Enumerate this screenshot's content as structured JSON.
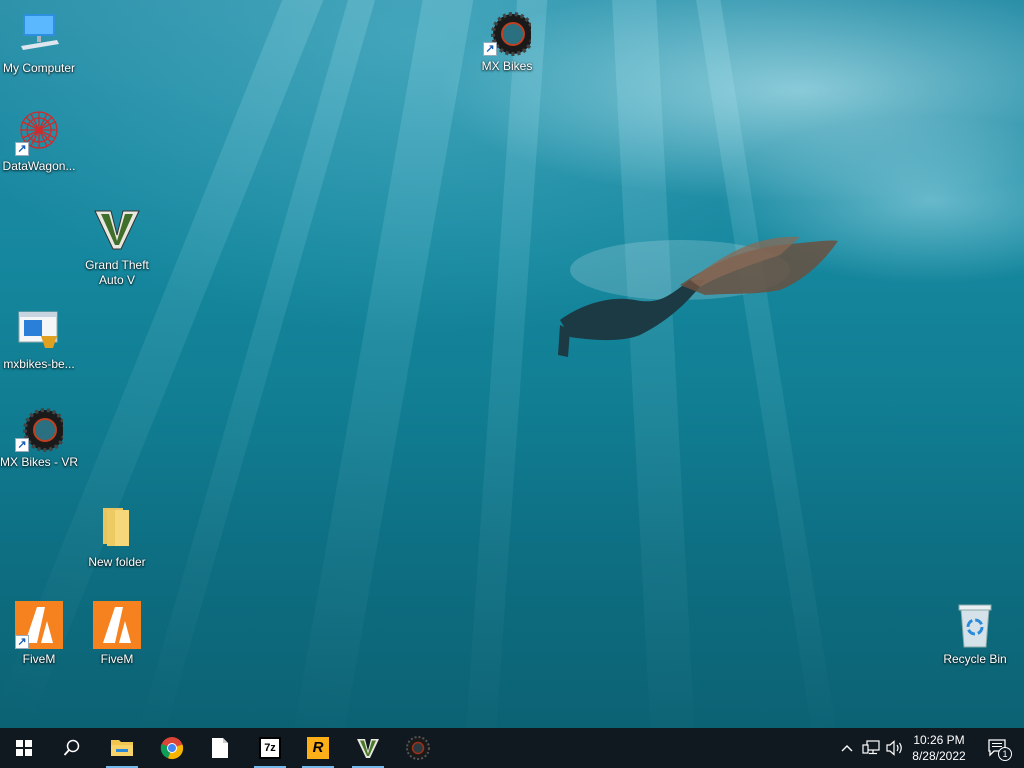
{
  "desktop": {
    "icons": [
      {
        "label": "My Computer",
        "icon": "computer-icon"
      },
      {
        "label": "DataWagon...",
        "icon": "datawagon-icon",
        "shortcut": true
      },
      {
        "label": "Grand Theft\nAuto V",
        "icon": "gta-v-icon"
      },
      {
        "label": "mxbikes-be...",
        "icon": "installer-icon"
      },
      {
        "label": "MX Bikes - VR",
        "icon": "tire-icon",
        "shortcut": true
      },
      {
        "label": "New folder",
        "icon": "folder-icon"
      },
      {
        "label": "FiveM",
        "icon": "fivem-icon",
        "shortcut": true
      },
      {
        "label": "FiveM",
        "icon": "fivem-icon"
      },
      {
        "label": "MX Bikes",
        "icon": "tire-icon",
        "shortcut": true
      },
      {
        "label": "Recycle Bin",
        "icon": "recycle-bin-icon"
      }
    ]
  },
  "taskbar": {
    "buttons": [
      {
        "name": "start-button",
        "icon": "windows-logo-icon"
      },
      {
        "name": "search-button",
        "icon": "search-icon"
      },
      {
        "name": "file-explorer",
        "icon": "folder-icon",
        "running": true
      },
      {
        "name": "chrome",
        "icon": "chrome-icon"
      },
      {
        "name": "notepad",
        "icon": "blank-document-icon"
      },
      {
        "name": "7zip",
        "icon": "7zip-icon",
        "text": "7z",
        "running": true
      },
      {
        "name": "rockstar-launcher",
        "icon": "rockstar-icon",
        "text": "R",
        "running": true
      },
      {
        "name": "gta-v",
        "icon": "gta-v-icon",
        "running": true
      },
      {
        "name": "mx-bikes",
        "icon": "tire-icon"
      }
    ],
    "tray": {
      "clock_time": "10:26 PM",
      "clock_date": "8/28/2022",
      "notification_count": "1"
    }
  },
  "colors": {
    "taskbar": "#101820",
    "accent": "#76b9ed",
    "fivem_orange": "#f5821f",
    "gta_green": "#4a7a2a"
  }
}
